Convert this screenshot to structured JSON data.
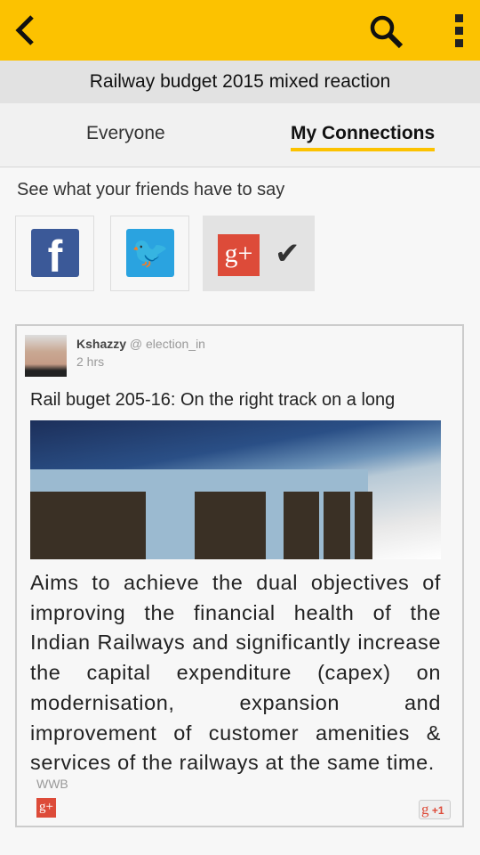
{
  "header": {
    "title": "Railway budget 2015 mixed reaction"
  },
  "tabs": [
    {
      "label": "Everyone",
      "active": false
    },
    {
      "label": "My Connections",
      "active": true
    }
  ],
  "friends": {
    "prompt": "See what your friends have to say",
    "networks": [
      {
        "name": "facebook",
        "glyph": "f"
      },
      {
        "name": "twitter",
        "glyph": "🐦"
      },
      {
        "name": "google-plus",
        "glyph": "g+",
        "selected": true
      }
    ],
    "check": "✔"
  },
  "post": {
    "author": "Kshazzy",
    "handle": "@ election_in",
    "time": "2 hrs",
    "headline": "Rail buget 205-16: On the right track on a long",
    "body": "Aims to achieve the dual objectives of improving the financial health of the Indian Railways and significantly increase the capital expenditure (capex) on modernisation, expansion and improvement of customer amenities & services of the railways at the same time.",
    "source": "WWB",
    "source_icon": "g+",
    "plus_one": {
      "g": "g",
      "label": "+1"
    }
  },
  "colors": {
    "accent": "#fcc200",
    "facebook": "#3b5998",
    "twitter": "#2aa3e0",
    "google": "#dd4b39"
  }
}
